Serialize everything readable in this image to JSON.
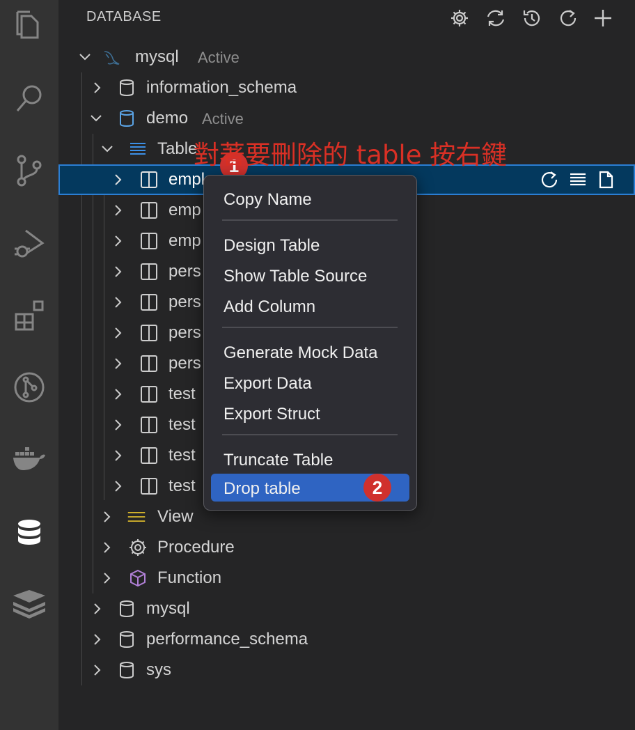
{
  "activity_bar": {
    "icons": [
      "files-icon",
      "search-icon",
      "source-control-icon",
      "run-debug-icon",
      "extensions-icon",
      "git-graph-icon",
      "docker-icon",
      "database-icon",
      "redis-icon"
    ]
  },
  "sidebar": {
    "title": "DATABASE",
    "actions": [
      "settings-icon",
      "sync-icon",
      "history-icon",
      "refresh-icon",
      "add-icon"
    ]
  },
  "tree": {
    "connection": {
      "label": "mysql",
      "status": "Active"
    },
    "schemas": {
      "information_schema": "information_schema",
      "demo": {
        "label": "demo",
        "status": "Active"
      },
      "mysql": "mysql",
      "performance_schema": "performance_schema",
      "sys": "sys"
    },
    "groups": {
      "table": "Table",
      "view": "View",
      "procedure": "Procedure",
      "function": "Function"
    },
    "tables": [
      "empl",
      "emp",
      "emp",
      "pers",
      "pers",
      "pers",
      "pers",
      "test",
      "test",
      "test",
      "test"
    ]
  },
  "context_menu": {
    "items": [
      "Copy Name",
      "Design Table",
      "Show Table Source",
      "Add Column",
      "Generate Mock Data",
      "Export Data",
      "Export Struct",
      "Truncate Table",
      "Drop table"
    ]
  },
  "annotation": {
    "text": "對著要刪除的 table 按右鍵",
    "step1": "1",
    "step2": "2",
    "color": "#d93025"
  },
  "colors": {
    "accent": "#2f64c2",
    "selection": "#04395e",
    "badge": "#d0312d"
  }
}
